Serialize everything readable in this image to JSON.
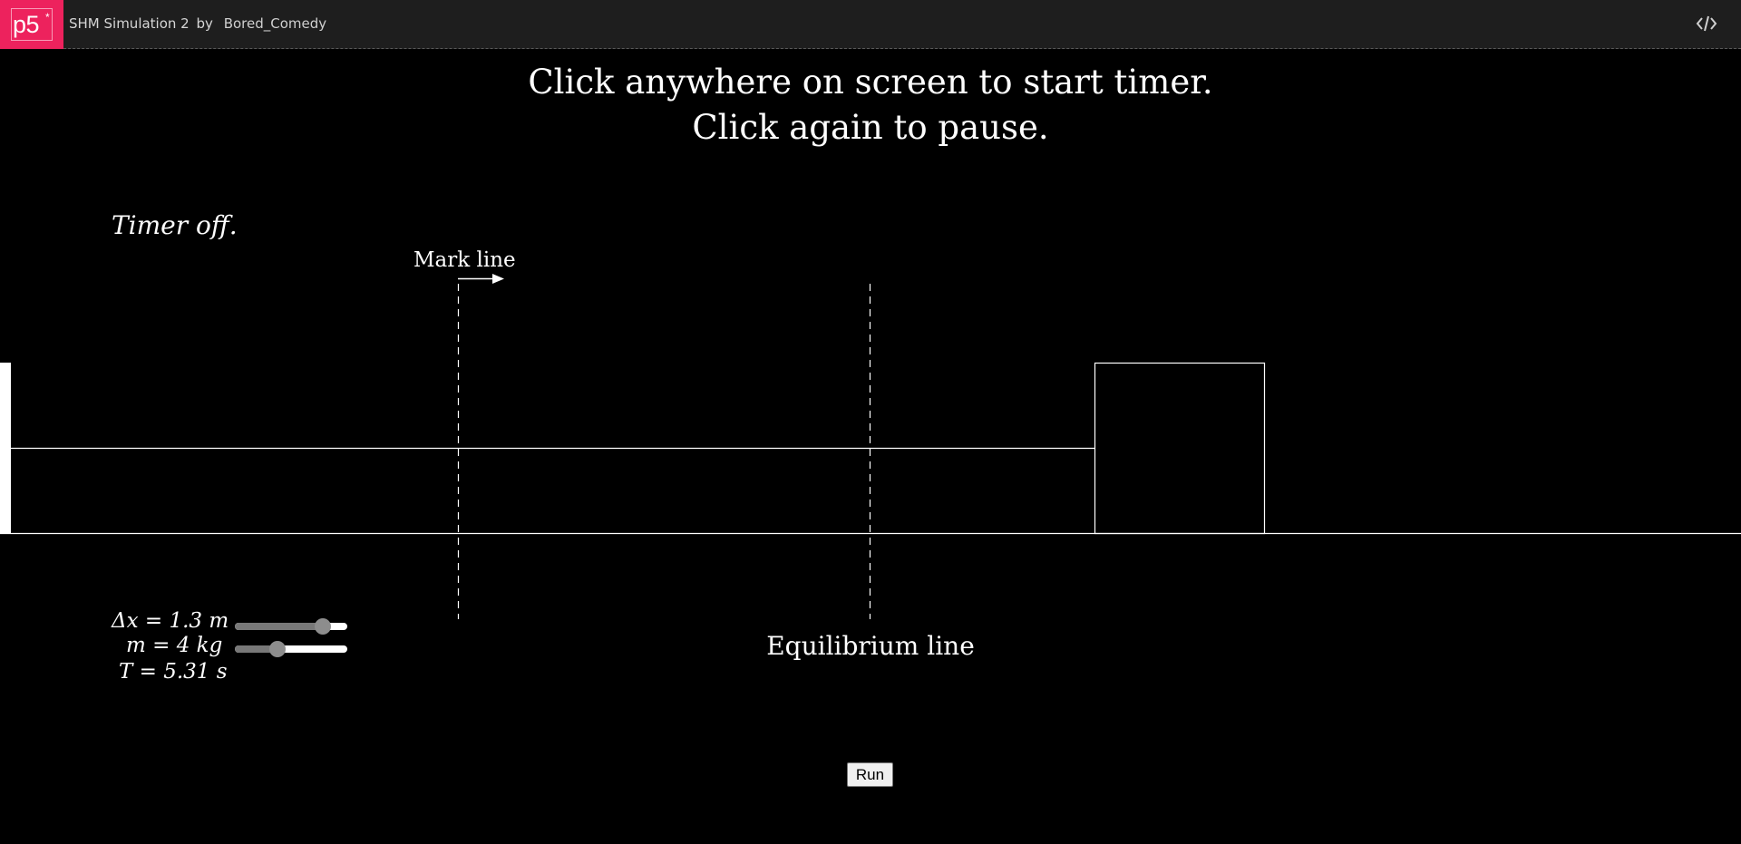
{
  "header": {
    "logo_text": "p5",
    "logo_star": "*",
    "sketch_title": "SHM Simulation 2",
    "by_label": "by",
    "author": "Bored_Comedy",
    "code_icon": "code-brackets-icon",
    "brand_color": "#ed225d"
  },
  "canvas": {
    "instructions": {
      "line1": "Click anywhere on screen to start timer.",
      "line2": "Click again to pause."
    },
    "timer_status": "Timer off.",
    "mark_line_label": "Mark line",
    "equilibrium_label": "Equilibrium line",
    "controls": {
      "displacement": {
        "label": "Δx = 1.3 m",
        "value": 1.3,
        "unit": "m",
        "slider_fraction": 0.78
      },
      "mass": {
        "label": "m = 4 kg",
        "value": 4,
        "unit": "kg",
        "slider_fraction": 0.38
      },
      "period": {
        "label": "T = 5.31 s",
        "value": 5.31,
        "unit": "s"
      }
    },
    "run_button_label": "Run"
  }
}
